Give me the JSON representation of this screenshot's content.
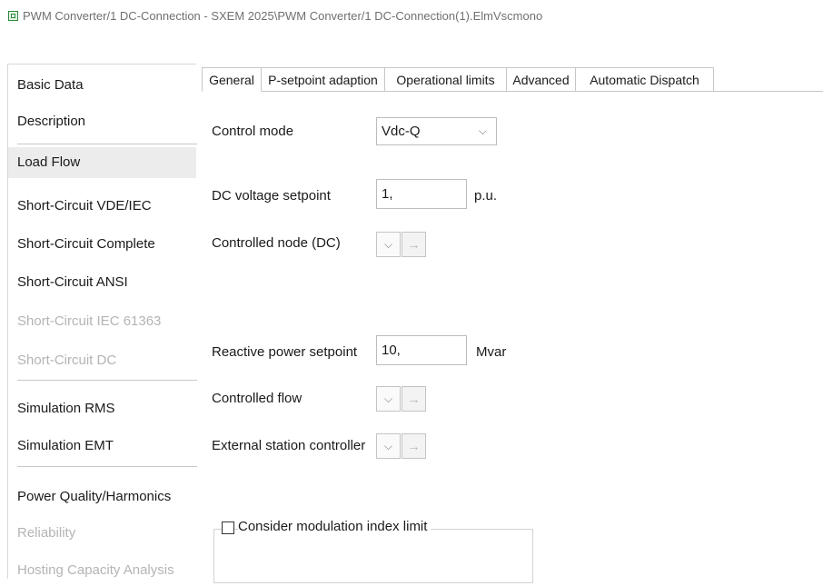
{
  "window": {
    "title": "PWM Converter/1 DC-Connection - SXEM 2025\\PWM Converter/1 DC-Connection(1).ElmVscmono",
    "icon": "grid-component-icon"
  },
  "sidebar": {
    "items": [
      {
        "label": "Basic Data",
        "state": "normal"
      },
      {
        "label": "Description",
        "state": "normal"
      },
      {
        "label": "Load Flow",
        "state": "selected"
      },
      {
        "label": "Short-Circuit VDE/IEC",
        "state": "normal"
      },
      {
        "label": "Short-Circuit Complete",
        "state": "normal"
      },
      {
        "label": "Short-Circuit ANSI",
        "state": "normal"
      },
      {
        "label": "Short-Circuit IEC 61363",
        "state": "disabled"
      },
      {
        "label": "Short-Circuit DC",
        "state": "disabled"
      },
      {
        "label": "Simulation RMS",
        "state": "normal"
      },
      {
        "label": "Simulation EMT",
        "state": "normal"
      },
      {
        "label": "Power Quality/Harmonics",
        "state": "normal"
      },
      {
        "label": "Reliability",
        "state": "disabled"
      },
      {
        "label": "Hosting Capacity Analysis",
        "state": "disabled"
      }
    ]
  },
  "tabs": [
    {
      "label": "General",
      "active": true
    },
    {
      "label": "P-setpoint adaption",
      "active": false
    },
    {
      "label": "Operational limits",
      "active": false
    },
    {
      "label": "Advanced",
      "active": false
    },
    {
      "label": "Automatic Dispatch",
      "active": false
    }
  ],
  "form": {
    "control_mode": {
      "label": "Control mode",
      "value": "Vdc-Q"
    },
    "dc_voltage": {
      "label": "DC voltage setpoint",
      "value": "1,",
      "unit": "p.u."
    },
    "controlled_node": {
      "label": "Controlled node (DC)"
    },
    "reactive_power": {
      "label": "Reactive power setpoint",
      "value": "10,",
      "unit": "Mvar"
    },
    "controlled_flow": {
      "label": "Controlled flow"
    },
    "external_controller": {
      "label": "External station controller"
    },
    "modulation_limit": {
      "label": "Consider modulation index limit",
      "checked": false
    }
  },
  "glyphs": {
    "chevron": "⌵",
    "arrow": "→"
  }
}
